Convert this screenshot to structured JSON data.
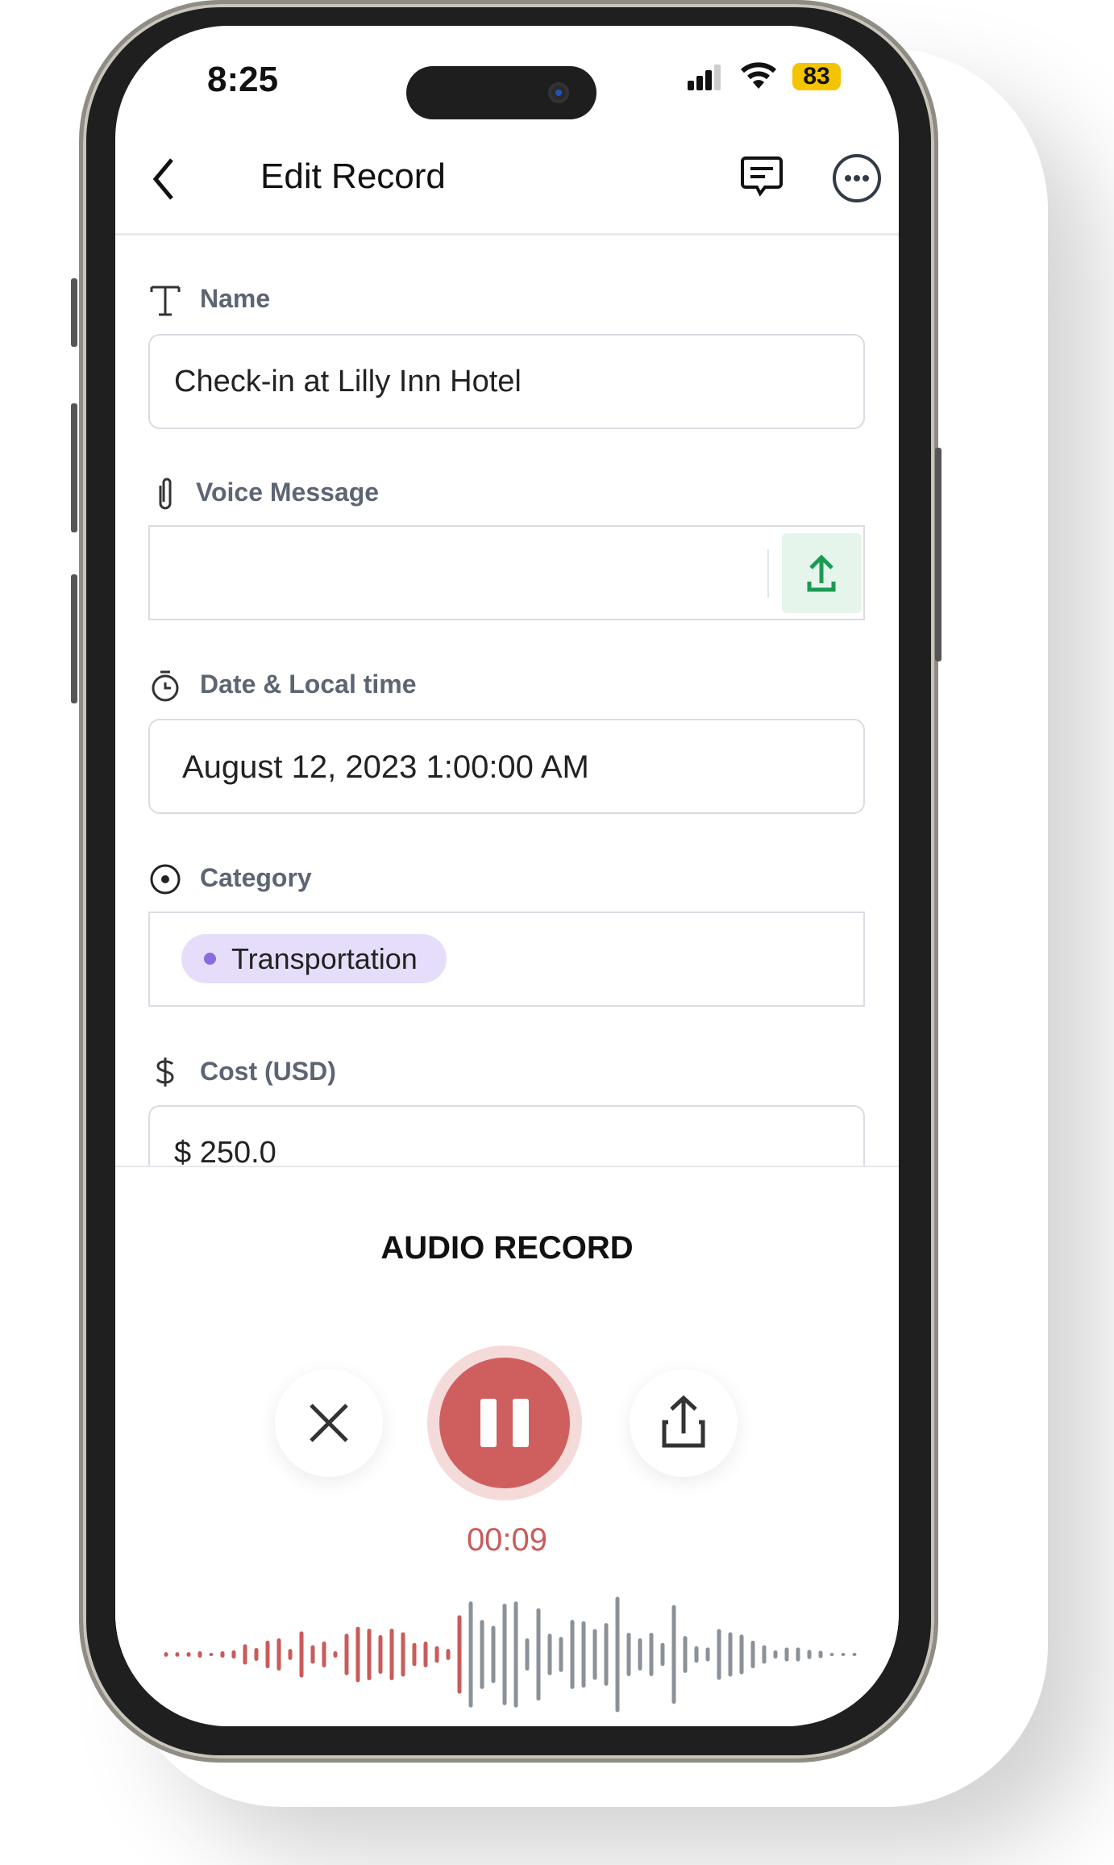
{
  "status_bar": {
    "time": "8:25",
    "battery": "83"
  },
  "header": {
    "title": "Edit Record",
    "back_icon": "chevron-left-icon",
    "comment_icon": "message-icon",
    "more_icon": "ellipsis-circle-icon"
  },
  "fields": {
    "name": {
      "label": "Name",
      "value": "Check-in at Lilly Inn Hotel"
    },
    "voice": {
      "label": "Voice Message",
      "value": ""
    },
    "date": {
      "label": "Date & Local time",
      "value": "August 12, 2023 1:00:00 AM"
    },
    "category": {
      "label": "Category",
      "value": "Transportation",
      "chip_color": "#e6ddfa"
    },
    "cost": {
      "label": "Cost (USD)",
      "value": "$ 250.0"
    }
  },
  "audio": {
    "title": "AUDIO RECORD",
    "timer": "00:09",
    "state": "recording",
    "accent": "#c95b5b",
    "played_color": "#c95b5b",
    "unplayed_color": "#8b9198",
    "played_bars": 27,
    "waveform": [
      10,
      10,
      10,
      14,
      6,
      14,
      18,
      44,
      28,
      60,
      70,
      24,
      100,
      40,
      56,
      14,
      90,
      120,
      112,
      84,
      112,
      96,
      50,
      56,
      36,
      24,
      170,
      230,
      150,
      124,
      220,
      230,
      70,
      200,
      90,
      76,
      150,
      144,
      110,
      136,
      250,
      94,
      70,
      94,
      50,
      214,
      80,
      36,
      30,
      110,
      96,
      86,
      60,
      40,
      18,
      30,
      30,
      20,
      16,
      6,
      6,
      6
    ]
  }
}
